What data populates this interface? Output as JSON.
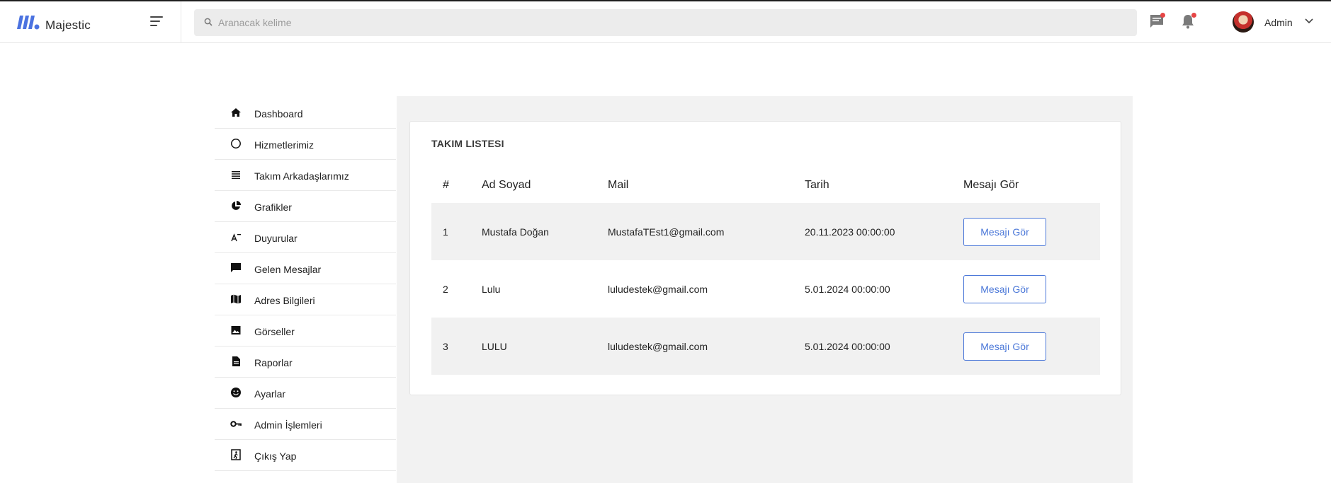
{
  "brand": {
    "name": "Majestic"
  },
  "search": {
    "placeholder": "Aranacak kelime"
  },
  "user": {
    "name": "Admin"
  },
  "sidebar": {
    "items": [
      {
        "label": "Dashboard",
        "icon": "home-icon"
      },
      {
        "label": "Hizmetlerimiz",
        "icon": "circle-icon"
      },
      {
        "label": "Takım Arkadaşlarımız",
        "icon": "list-icon"
      },
      {
        "label": "Grafikler",
        "icon": "pie-chart-icon"
      },
      {
        "label": "Duyurular",
        "icon": "text-icon"
      },
      {
        "label": "Gelen Mesajlar",
        "icon": "message-icon"
      },
      {
        "label": "Adres Bilgileri",
        "icon": "map-icon"
      },
      {
        "label": "Görseller",
        "icon": "image-icon"
      },
      {
        "label": "Raporlar",
        "icon": "document-icon"
      },
      {
        "label": "Ayarlar",
        "icon": "smile-icon"
      },
      {
        "label": "Admin İşlemleri",
        "icon": "key-icon"
      },
      {
        "label": "Çıkış Yap",
        "icon": "exit-icon"
      }
    ]
  },
  "card": {
    "title": "TAKIM LISTESI",
    "columns": [
      "#",
      "Ad Soyad",
      "Mail",
      "Tarih",
      "Mesajı Gör"
    ],
    "rows": [
      {
        "no": "1",
        "name": "Mustafa Doğan",
        "mail": "MustafaTEst1@gmail.com",
        "date": "20.11.2023 00:00:00",
        "button": "Mesajı Gör"
      },
      {
        "no": "2",
        "name": "Lulu",
        "mail": "luludestek@gmail.com",
        "date": "5.01.2024 00:00:00",
        "button": "Mesajı Gör"
      },
      {
        "no": "3",
        "name": "LULU",
        "mail": "luludestek@gmail.com",
        "date": "5.01.2024 00:00:00",
        "button": "Mesajı Gör"
      }
    ]
  },
  "colors": {
    "accent": "#4a77d8",
    "brand_blue": "#4b72e0",
    "notification": "#e64545"
  }
}
